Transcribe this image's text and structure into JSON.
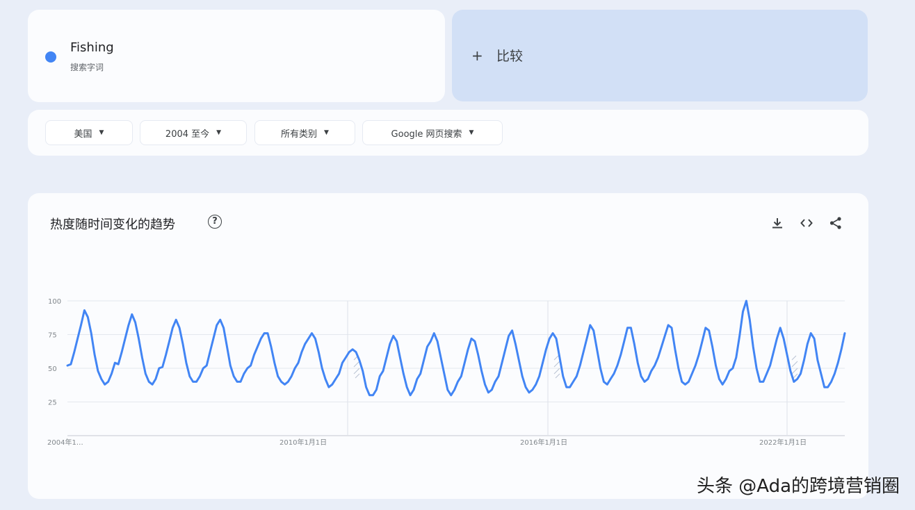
{
  "search_term": {
    "name": "Fishing",
    "type_label": "搜索字词",
    "color": "#4285f4"
  },
  "compare": {
    "plus": "+",
    "label": "比较"
  },
  "filters": [
    {
      "label": "美国"
    },
    {
      "label": "2004 至今"
    },
    {
      "label": "所有类别"
    },
    {
      "label": "Google 网页搜索"
    }
  ],
  "chart_section": {
    "title": "热度随时间变化的趋势",
    "help_icon": "help-circle-icon",
    "actions": [
      "download-icon",
      "embed-code-icon",
      "share-icon"
    ]
  },
  "chart_data": {
    "type": "line",
    "series": [
      {
        "name": "Fishing",
        "color": "#4285f4",
        "values": [
          52,
          53,
          62,
          72,
          82,
          93,
          88,
          76,
          60,
          48,
          42,
          38,
          40,
          46,
          54,
          53,
          62,
          72,
          82,
          90,
          84,
          72,
          58,
          46,
          40,
          38,
          42,
          50,
          51,
          60,
          70,
          80,
          86,
          80,
          68,
          54,
          44,
          40,
          40,
          44,
          50,
          52,
          62,
          72,
          82,
          86,
          80,
          66,
          52,
          44,
          40,
          40,
          46,
          50,
          52,
          60,
          66,
          72,
          76,
          76,
          66,
          54,
          44,
          40,
          38,
          40,
          44,
          50,
          54,
          62,
          68,
          72,
          76,
          72,
          62,
          50,
          42,
          36,
          38,
          42,
          46,
          54,
          58,
          62,
          64,
          62,
          56,
          48,
          36,
          30,
          30,
          34,
          44,
          48,
          58,
          68,
          74,
          70,
          58,
          46,
          36,
          30,
          34,
          42,
          46,
          56,
          66,
          70,
          76,
          70,
          58,
          46,
          34,
          30,
          34,
          40,
          44,
          54,
          64,
          72,
          70,
          60,
          48,
          38,
          32,
          34,
          40,
          44,
          54,
          64,
          74,
          78,
          68,
          56,
          44,
          36,
          32,
          34,
          38,
          44,
          54,
          64,
          72,
          76,
          72,
          58,
          44,
          36,
          36,
          40,
          44,
          52,
          62,
          72,
          82,
          78,
          64,
          50,
          40,
          38,
          42,
          46,
          52,
          60,
          70,
          80,
          80,
          68,
          54,
          44,
          40,
          42,
          48,
          52,
          58,
          66,
          74,
          82,
          80,
          64,
          50,
          40,
          38,
          40,
          46,
          52,
          60,
          70,
          80,
          78,
          66,
          52,
          42,
          38,
          42,
          48,
          50,
          58,
          74,
          92,
          100,
          86,
          66,
          50,
          40,
          40,
          46,
          52,
          62,
          72,
          80,
          72,
          60,
          48,
          40,
          42,
          46,
          56,
          68,
          76,
          72,
          56,
          46,
          36,
          36,
          40,
          46,
          54,
          64,
          76
        ]
      }
    ],
    "y_ticks": [
      "100",
      "75",
      "50",
      "25"
    ],
    "x_tick_labels": [
      "2004年1…",
      "2010年1月1日",
      "2016年1月1日",
      "2022年1月1日"
    ],
    "ylim": [
      0,
      100
    ],
    "grid": true,
    "partial_data_markers": 4
  },
  "watermark": "头条 @Ada的跨境营销圈"
}
